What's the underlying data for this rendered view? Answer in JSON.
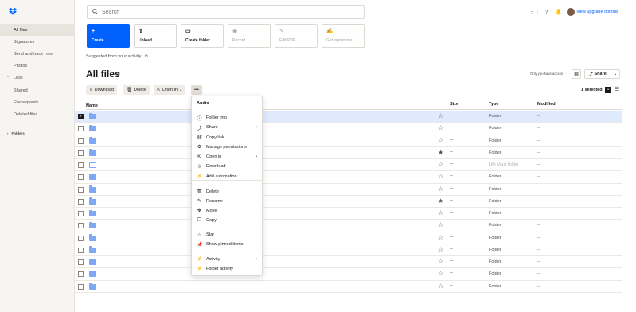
{
  "sidebar": {
    "logo": "dropbox-logo-icon",
    "items": [
      {
        "label": "All files",
        "active": true
      },
      {
        "label": "Signatures"
      },
      {
        "label": "Send and track",
        "badge": "New"
      },
      {
        "label": "Photos"
      },
      {
        "label": "Less",
        "chevron": "^"
      },
      {
        "label": "Shared"
      },
      {
        "label": "File requests"
      },
      {
        "label": "Deleted files"
      }
    ],
    "folders_label": "Folders"
  },
  "search": {
    "placeholder": "Search"
  },
  "topbar": {
    "upgrade_label": "View upgrade options"
  },
  "actions": [
    {
      "label": "Create",
      "icon": "+"
    },
    {
      "label": "Upload",
      "icon": "⇧"
    },
    {
      "label": "Create folder",
      "icon": "▭"
    },
    {
      "label": "Record",
      "icon": "◉"
    },
    {
      "label": "Edit PDF",
      "icon": "✎"
    },
    {
      "label": "Get signatures",
      "icon": "✍"
    }
  ],
  "suggested": "Suggested from your activity",
  "page": {
    "title": "All files",
    "access": "Only you have access",
    "share_label": "Share"
  },
  "toolbar": {
    "download": "Download",
    "delete": "Delete",
    "open_in": "Open in",
    "more": "•••",
    "selected": "1 selected"
  },
  "table": {
    "headers": {
      "name": "Name",
      "size": "Size",
      "type": "Type",
      "modified": "Modified"
    },
    "rows": [
      {
        "type": "Folder",
        "size": "--",
        "modified": "--",
        "starred": false,
        "selected": true
      },
      {
        "type": "Folder",
        "size": "--",
        "modified": "--",
        "starred": false
      },
      {
        "type": "Folder",
        "size": "--",
        "modified": "--",
        "starred": false
      },
      {
        "type": "Folder",
        "size": "--",
        "modified": "--",
        "starred": true
      },
      {
        "type": "Life Vault folder",
        "size": "--",
        "modified": "--",
        "starred": false,
        "vault": true
      },
      {
        "type": "Folder",
        "size": "--",
        "modified": "--",
        "starred": false
      },
      {
        "type": "Folder",
        "size": "--",
        "modified": "--",
        "starred": false
      },
      {
        "type": "Folder",
        "size": "--",
        "modified": "--",
        "starred": true
      },
      {
        "type": "Folder",
        "size": "--",
        "modified": "--",
        "starred": false
      },
      {
        "type": "Folder",
        "size": "--",
        "modified": "--",
        "starred": false
      },
      {
        "type": "Folder",
        "size": "--",
        "modified": "--",
        "starred": false
      },
      {
        "type": "Folder",
        "size": "--",
        "modified": "--",
        "starred": false
      },
      {
        "type": "Folder",
        "size": "--",
        "modified": "--",
        "starred": false
      },
      {
        "type": "Folder",
        "size": "--",
        "modified": "--",
        "starred": false
      },
      {
        "type": "Folder",
        "size": "--",
        "modified": "--",
        "starred": false
      }
    ]
  },
  "menu": {
    "title": "Audio",
    "items": [
      {
        "label": "Folder info",
        "icon": "ⓘ"
      },
      {
        "label": "Share",
        "icon": "⤴",
        "submenu": true
      },
      {
        "label": "Copy link",
        "icon": "⛓"
      },
      {
        "label": "Manage permissions",
        "icon": "⚙"
      },
      {
        "label": "Open in",
        "icon": "⇱",
        "submenu": true
      },
      {
        "label": "Download",
        "icon": "⇩"
      },
      {
        "label": "Add automation",
        "icon": "⚡"
      },
      {
        "label": "Delete",
        "icon": "🗑"
      },
      {
        "label": "Rename",
        "icon": "✎"
      },
      {
        "label": "Move",
        "icon": "✥"
      },
      {
        "label": "Copy",
        "icon": "❐"
      },
      {
        "label": "Star",
        "icon": "☆"
      },
      {
        "label": "Show pinned items",
        "icon": "📌"
      },
      {
        "label": "Activity",
        "icon": "⚡",
        "submenu": true
      },
      {
        "label": "Folder activity",
        "icon": "⚡"
      }
    ]
  }
}
